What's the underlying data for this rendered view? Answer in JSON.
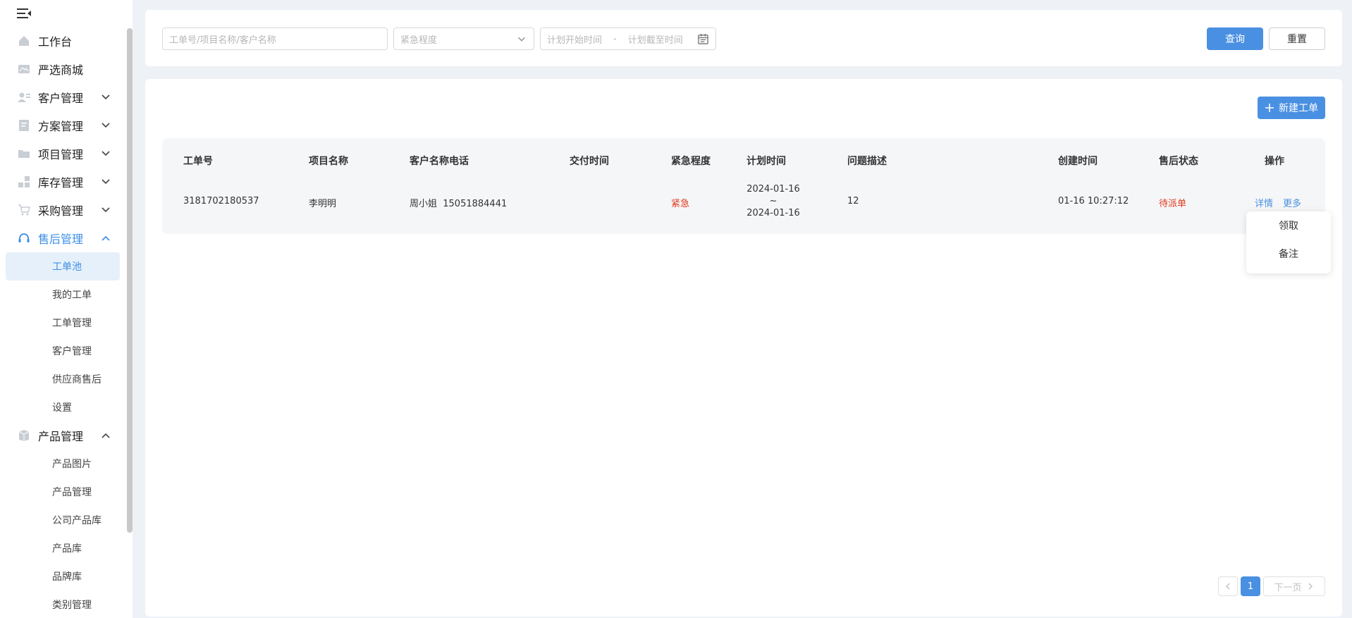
{
  "sidebar": {
    "menu": [
      {
        "label": "工作台",
        "icon": "home-icon",
        "expandable": false
      },
      {
        "label": "严选商城",
        "icon": "mall-icon",
        "expandable": false
      },
      {
        "label": "客户管理",
        "icon": "customer-icon",
        "expandable": true,
        "expanded": false
      },
      {
        "label": "方案管理",
        "icon": "plan-icon",
        "expandable": true,
        "expanded": false
      },
      {
        "label": "项目管理",
        "icon": "folder-icon",
        "expandable": true,
        "expanded": false
      },
      {
        "label": "库存管理",
        "icon": "inventory-icon",
        "expandable": true,
        "expanded": false
      },
      {
        "label": "采购管理",
        "icon": "cart-icon",
        "expandable": true,
        "expanded": false
      },
      {
        "label": "售后管理",
        "icon": "headset-icon",
        "expandable": true,
        "expanded": true,
        "active": true
      },
      {
        "label": "产品管理",
        "icon": "product-icon",
        "expandable": true,
        "expanded": true
      }
    ],
    "aftersale_sub": [
      "工单池",
      "我的工单",
      "工单管理",
      "客户管理",
      "供应商售后",
      "设置"
    ],
    "product_sub": [
      "产品图片",
      "产品管理",
      "公司产品库",
      "产品库",
      "品牌库",
      "类别管理"
    ]
  },
  "filter": {
    "keyword_placeholder": "工单号/项目名称/客户名称",
    "urgency_placeholder": "紧急程度",
    "start_placeholder": "计划开始时间",
    "range_sep": "-",
    "end_placeholder": "计划截至时间",
    "query_label": "查询",
    "reset_label": "重置"
  },
  "main": {
    "new_button_label": "新建工单",
    "columns": [
      "工单号",
      "项目名称",
      "客户名称电话",
      "交付时间",
      "紧急程度",
      "计划时间",
      "问题描述",
      "创建时间",
      "售后状态",
      "操作"
    ],
    "rows": [
      {
        "order_no": "3181702180537",
        "project": "李明明",
        "customer": "周小姐  15051884441",
        "delivery": "",
        "urgency": "紧急",
        "plan_start": "2024-01-16",
        "plan_sep": "~",
        "plan_end": "2024-01-16",
        "desc": "12",
        "created": "01-16 10:27:12",
        "status": "待派单",
        "action_detail": "详情",
        "action_more": "更多"
      }
    ],
    "more_menu": [
      "领取",
      "备注"
    ],
    "pagination": {
      "current": "1",
      "next_label": "下一页"
    }
  },
  "colors": {
    "accent": "#4a90e2",
    "urgent": "#e03a1e",
    "status": "#e03a1e"
  }
}
